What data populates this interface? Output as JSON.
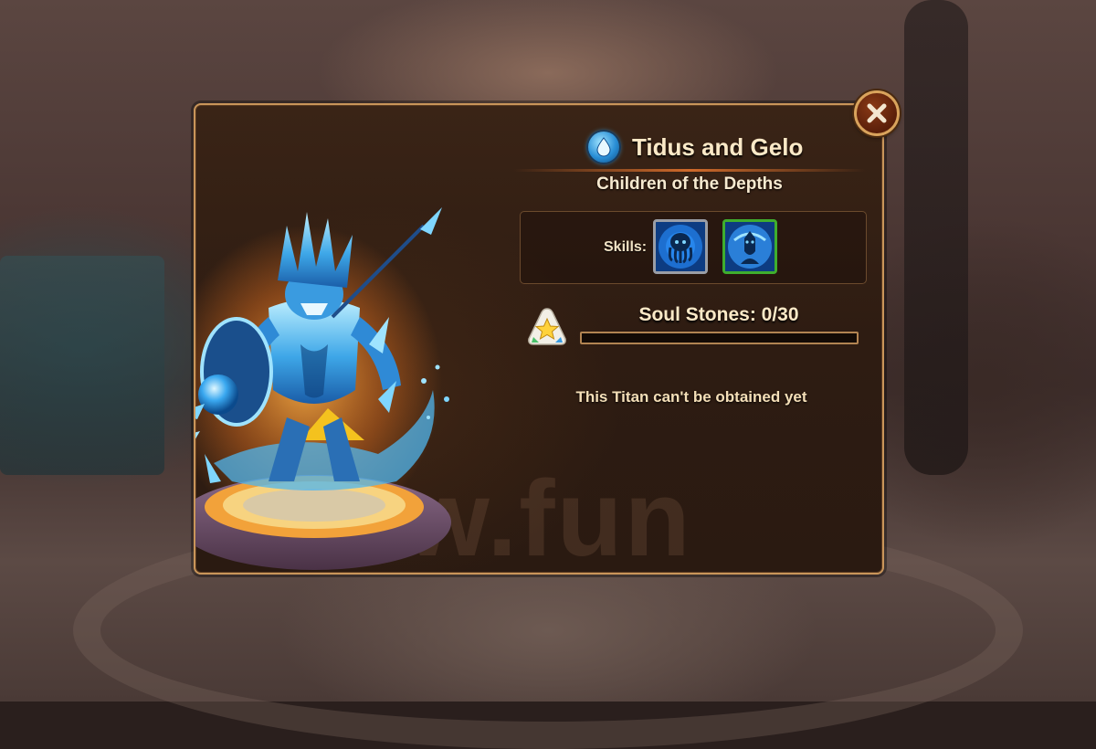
{
  "dialog": {
    "hero_name": "Tidus and Gelo",
    "subtitle": "Children of the Depths",
    "element_icon": "water-drop-icon",
    "skills": {
      "label": "Skills:",
      "items": [
        {
          "icon": "octopus-skill-icon",
          "frame_color": "#9a9ea6"
        },
        {
          "icon": "water-guardian-skill-icon",
          "frame_color": "#3fae2e"
        }
      ]
    },
    "soul_stones": {
      "label": "Soul Stones: 0/30",
      "current": 0,
      "required": 30,
      "icon": "star-soul-stone-icon"
    },
    "note": "This Titan can't be obtained yet",
    "close_icon": "close-icon"
  },
  "watermark": "w.fun",
  "colors": {
    "frame": "#c9955a",
    "panel_bg": "#2e1c12",
    "title_text": "#fbe9c7",
    "water_accent": "#3bb4ff",
    "progress_fill": "#ffd66a"
  }
}
